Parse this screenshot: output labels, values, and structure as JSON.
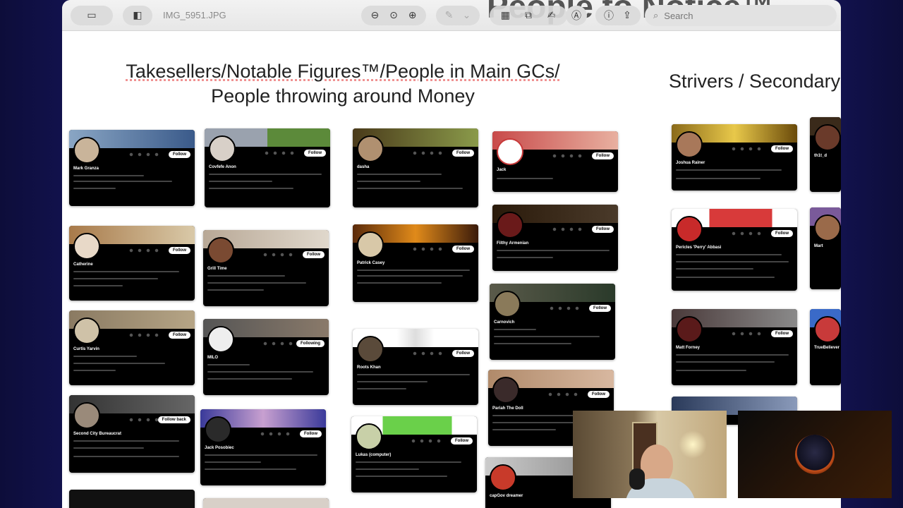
{
  "window": {
    "title": "IMG_5951.JPG",
    "ghost_heading": "People to Notice™",
    "search_placeholder": "Search"
  },
  "toolbar": {
    "left_icons": [
      "sidebar-toggle-icon",
      "view-mode-icon"
    ],
    "zoom_icons": [
      "zoom-out-icon",
      "zoom-actual-icon",
      "zoom-in-icon"
    ],
    "markup_icons": [
      "markup-pen-icon",
      "chevron-down-icon"
    ],
    "tool_icons": [
      "crop-icon",
      "rotate-icon",
      "annotate-icon",
      "accessibility-icon",
      "info-icon",
      "share-icon"
    ]
  },
  "headings": {
    "left_line1": "Takesellers/Notable Figures™/People in Main GCs/",
    "left_line2": "People throwing around Money",
    "right": "Strivers / Secondary"
  },
  "cards": [
    {
      "name": "Mark Granza",
      "button": "Follow"
    },
    {
      "name": "Catherine",
      "button": "Follow"
    },
    {
      "name": "Curtis Yarvin",
      "button": "Follow"
    },
    {
      "name": "Second City Bureaucrat",
      "button": "Follow back"
    },
    {
      "name": "Covfefe Anon",
      "button": "Follow"
    },
    {
      "name": "Grill Time",
      "button": "Follow"
    },
    {
      "name": "MILO",
      "button": "Following"
    },
    {
      "name": "Jack Posobiec",
      "button": "Follow"
    },
    {
      "name": "dasha",
      "button": "Follow"
    },
    {
      "name": "Patrick Casey",
      "button": "Follow"
    },
    {
      "name": "Roots Khan",
      "button": "Follow"
    },
    {
      "name": "Lukas (computer)",
      "button": "Follow"
    },
    {
      "name": "Jack",
      "button": "Follow"
    },
    {
      "name": "Filthy Armenian",
      "button": "Follow"
    },
    {
      "name": "Carnovich",
      "button": "Follow"
    },
    {
      "name": "Pariah The Doll",
      "button": "Follow"
    },
    {
      "name": "capGov dreamer",
      "button": "Follow"
    },
    {
      "name": "Joshua Rainer",
      "button": "Follow"
    },
    {
      "name": "Pericles 'Perry' Abbasi",
      "button": "Follow"
    },
    {
      "name": "Matt Forney",
      "button": "Follow"
    },
    {
      "name": "th1t_d",
      "button": "Follow"
    },
    {
      "name": "Mart",
      "button": "Follow"
    },
    {
      "name": "TrueBeliever",
      "button": "Follow"
    }
  ],
  "colors": {
    "page_bg": "#1b1b70",
    "card_bg": "#000000",
    "accent_orange": "#c8501a"
  }
}
